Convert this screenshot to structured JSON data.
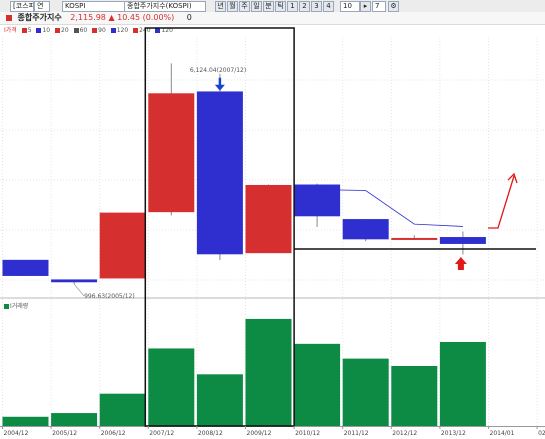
{
  "toolbar": {
    "market": "[코스피]",
    "period": "연",
    "code": "KOSPI",
    "name": "종합주가지수(KOSPI)",
    "count": "10",
    "buttons": [
      "년",
      "월",
      "주",
      "일",
      "분",
      "틱",
      "1",
      "2",
      "3",
      "4"
    ],
    "page": "7"
  },
  "info": {
    "name": "종합주가지수",
    "price": "2,115.98",
    "change_symbol": "▲",
    "change": "10.45",
    "change_pct": "(0.00%)",
    "volume": "0"
  },
  "colors": {
    "up": "#d62f2f",
    "down": "#2f2fd0",
    "volume": "#0d8a44",
    "arrow_down": "#1244d6",
    "arrow_up": "#e01818"
  },
  "chart_data": [
    {
      "type": "candlestick",
      "title": "",
      "legend_label": "I가격",
      "legend": [
        "5",
        "10",
        "20",
        "60",
        "90",
        "120",
        "240",
        "120"
      ],
      "legend_colors": [
        "#d62f2f",
        "#2f2fd0",
        "#d62f2f",
        "#555555",
        "#d62f2f",
        "#2f2fd0",
        "#d62f2f",
        "#2f2fd0"
      ],
      "x": [
        "2004/12",
        "2005/12",
        "2006/12",
        "2007/12",
        "2008/12",
        "2009/12",
        "2010/12",
        "2011/12",
        "2012/12",
        "2013/12"
      ],
      "candles": [
        {
          "x": "2004/12",
          "open": 1085,
          "high": 1085,
          "low": 735,
          "close": 735
        },
        {
          "x": "2005/12",
          "open": 660,
          "high": 660,
          "low": 560,
          "close": 598
        },
        {
          "x": "2006/12",
          "open": 681,
          "high": 2110,
          "low": 681,
          "close": 2110
        },
        {
          "x": "2007/12",
          "open": 2120,
          "high": 5350,
          "low": 2050,
          "close": 4700
        },
        {
          "x": "2008/12",
          "open": 4740,
          "high": 5124,
          "low": 1080,
          "close": 1205
        },
        {
          "x": "2009/12",
          "open": 1230,
          "high": 2720,
          "low": 1230,
          "close": 2710
        },
        {
          "x": "2010/12",
          "open": 2720,
          "high": 2740,
          "low": 1800,
          "close": 2030
        },
        {
          "x": "2011/12",
          "open": 1970,
          "high": 1970,
          "low": 1490,
          "close": 1530
        },
        {
          "x": "2012/12",
          "open": 1520,
          "high": 1620,
          "low": 1520,
          "close": 1560
        },
        {
          "x": "2013/12",
          "open": 1580,
          "high": 1700,
          "low": 1200,
          "close": 1430
        }
      ],
      "moving_average": [
        {
          "x": "2010/12",
          "y": 2610
        },
        {
          "x": "2011/12",
          "y": 2590
        },
        {
          "x": "2012/12",
          "y": 1860
        },
        {
          "x": "2013/12",
          "y": 1810
        }
      ],
      "annotations": {
        "high_label": "6,124.04(2007/12)",
        "low_label": "996.63(2005/12)"
      },
      "ylim": [
        300,
        5900
      ]
    },
    {
      "type": "bar",
      "legend_label": "I거래량",
      "categories": [
        "2004/12",
        "2005/12",
        "2006/12",
        "2007/12",
        "2008/12",
        "2009/12",
        "2010/12",
        "2011/12",
        "2012/12",
        "2013/12"
      ],
      "values": [
        10,
        14,
        35,
        84,
        56,
        116,
        89,
        73,
        65,
        91
      ],
      "ylim": [
        0,
        130
      ]
    }
  ],
  "x_axis": {
    "labels": [
      "2004/12",
      "2005/12",
      "2006/12",
      "2007/12",
      "2008/12",
      "2009/12",
      "2010/12",
      "2011/12",
      "2012/12",
      "2013/12",
      "2014/01",
      "02"
    ]
  }
}
